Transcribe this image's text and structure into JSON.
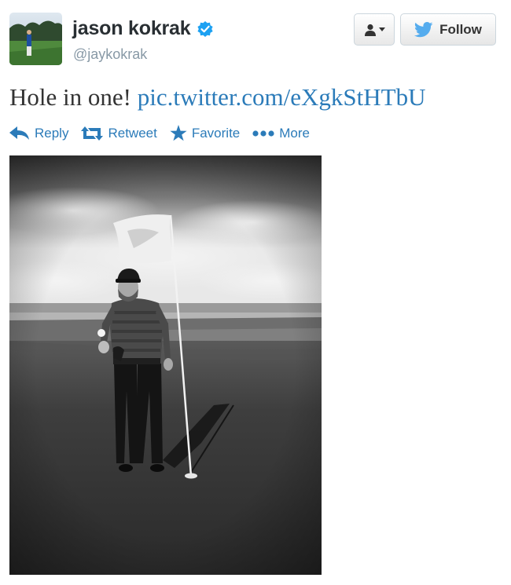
{
  "user": {
    "full_name": "jason kokrak",
    "screen_name": "@jaykokrak",
    "verified": true
  },
  "buttons": {
    "follow_label": "Follow"
  },
  "tweet": {
    "text_plain": "Hole in one! ",
    "link_text": "pic.twitter.com/eXgkStHTbU"
  },
  "actions": [
    {
      "label": "Reply",
      "icon": "reply-icon"
    },
    {
      "label": "Retweet",
      "icon": "retweet-icon"
    },
    {
      "label": "Favorite",
      "icon": "star-icon"
    },
    {
      "label": "More",
      "icon": "more-dots-icon"
    }
  ],
  "colors": {
    "link": "#2b7bb9",
    "verified_badge": "#1da1f2",
    "twitter_bird": "#55acee",
    "muted": "#8899a6"
  }
}
